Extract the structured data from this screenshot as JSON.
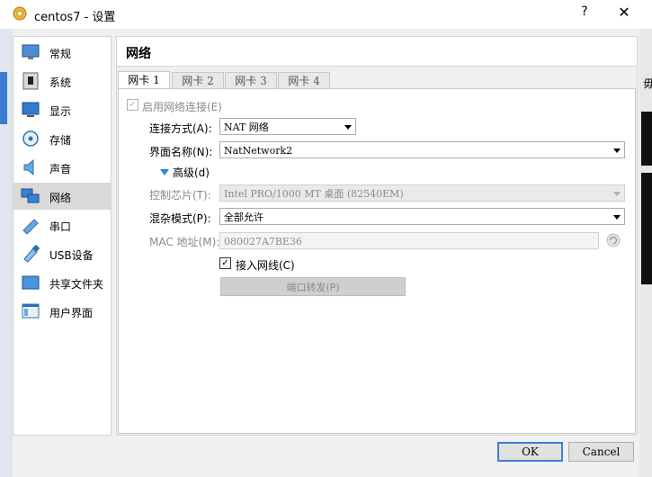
{
  "window": {
    "title": "centos7 - 设置",
    "help_label": "?",
    "close_label": "✕",
    "bg_text": "毋"
  },
  "sidebar": {
    "items": [
      {
        "label": "常规",
        "icon": "general-icon"
      },
      {
        "label": "系统",
        "icon": "system-icon"
      },
      {
        "label": "显示",
        "icon": "display-icon"
      },
      {
        "label": "存储",
        "icon": "storage-icon"
      },
      {
        "label": "声音",
        "icon": "audio-icon"
      },
      {
        "label": "网络",
        "icon": "network-icon",
        "selected": true
      },
      {
        "label": "串口",
        "icon": "serial-port-icon"
      },
      {
        "label": "USB设备",
        "icon": "usb-icon"
      },
      {
        "label": "共享文件夹",
        "icon": "shared-folder-icon"
      },
      {
        "label": "用户界面",
        "icon": "user-interface-icon"
      }
    ]
  },
  "section": {
    "title": "网络"
  },
  "tabs": [
    {
      "label": "网卡 1",
      "active": true
    },
    {
      "label": "网卡 2"
    },
    {
      "label": "网卡 3"
    },
    {
      "label": "网卡 4"
    }
  ],
  "adapter": {
    "enable_label": "启用网络连接(E)",
    "enable_checked": true,
    "attached_label": "连接方式(A):",
    "attached_value": "NAT 网络",
    "name_label": "界面名称(N):",
    "name_value": "NatNetwork2",
    "advanced_label": "高级(d)",
    "adapter_type_label": "控制芯片(T):",
    "adapter_type_value": "Intel PRO/1000 MT 桌面 (82540EM)",
    "promisc_label": "混杂模式(P):",
    "promisc_value": "全部允许",
    "mac_label": "MAC 地址(M):",
    "mac_value": "080027A7BE36",
    "cable_label": "接入网线(C)",
    "cable_checked": true,
    "port_forward_label": "端口转发(P)"
  },
  "buttons": {
    "ok": "OK",
    "cancel": "Cancel"
  },
  "colors": {
    "accent": "#2a86d6",
    "default_button_border": "#3c7fd4"
  }
}
